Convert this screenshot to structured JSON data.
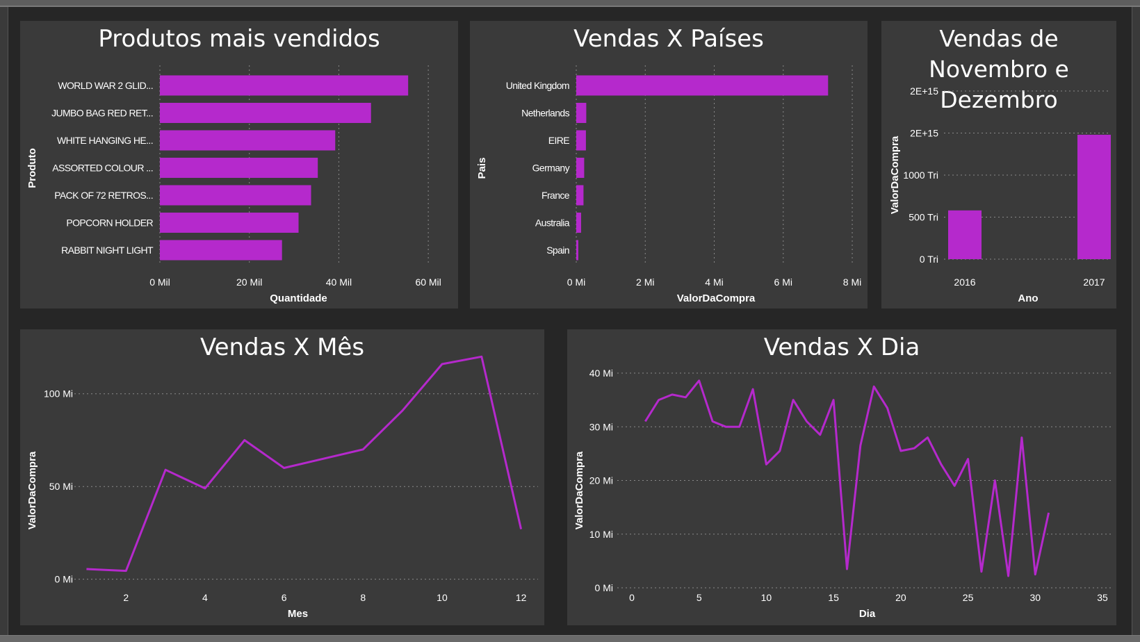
{
  "dashboard": {
    "accent_color": "#b529cc",
    "background_color": "#262626",
    "panel_color": "#3a3a3a"
  },
  "chart_data": [
    {
      "id": "produtos",
      "type": "bar",
      "orientation": "horizontal",
      "title": "Produtos mais vendidos",
      "xlabel": "Quantidade",
      "ylabel": "Produto",
      "categories": [
        "WORLD WAR 2 GLID...",
        "JUMBO BAG RED RET...",
        "WHITE HANGING HE...",
        "ASSORTED COLOUR ...",
        "PACK OF 72 RETROS...",
        "POPCORN HOLDER",
        "RABBIT NIGHT LIGHT"
      ],
      "values": [
        55500,
        47200,
        39200,
        35300,
        33800,
        31000,
        27300
      ],
      "xlim": [
        0,
        62000
      ],
      "xticks": [
        0,
        20000,
        40000,
        60000
      ],
      "xtick_labels": [
        "0 Mil",
        "20 Mil",
        "40 Mil",
        "60 Mil"
      ],
      "grid": "vertical-dotted"
    },
    {
      "id": "paises",
      "type": "bar",
      "orientation": "horizontal",
      "title": "Vendas X Países",
      "xlabel": "ValorDaCompra",
      "ylabel": "Pais",
      "categories": [
        "United Kingdom",
        "Netherlands",
        "EIRE",
        "Germany",
        "France",
        "Australia",
        "Spain"
      ],
      "values": [
        7300000,
        290000,
        280000,
        230000,
        210000,
        140000,
        60000
      ],
      "xlim": [
        0,
        8100000
      ],
      "xticks": [
        0,
        2000000,
        4000000,
        6000000,
        8000000
      ],
      "xtick_labels": [
        "0 Mi",
        "2 Mi",
        "4 Mi",
        "6 Mi",
        "8 Mi"
      ],
      "grid": "vertical-dotted"
    },
    {
      "id": "novdez",
      "type": "bar",
      "title": "Vendas de Novembro e Dezembro",
      "xlabel": "Ano",
      "ylabel": "ValorDaCompra",
      "categories": [
        "2016",
        "2017"
      ],
      "values": [
        580000000000000,
        1480000000000000
      ],
      "ylim": [
        0,
        2000000000000000
      ],
      "yticks": [
        0,
        500000000000000,
        1000000000000000,
        1500000000000000,
        2000000000000000
      ],
      "ytick_labels": [
        "0 Tri",
        "500 Tri",
        "1000 Tri",
        "2E+15",
        "2E+15"
      ],
      "grid": "horizontal-dotted"
    },
    {
      "id": "mes",
      "type": "line",
      "title": "Vendas X Mês",
      "xlabel": "Mes",
      "ylabel": "ValorDaCompra",
      "x": [
        1,
        2,
        3,
        4,
        5,
        6,
        7,
        8,
        9,
        10,
        11,
        12
      ],
      "y": [
        5500000,
        4500000,
        59000000,
        49000000,
        75000000,
        60000000,
        65000000,
        70000000,
        91000000,
        116000000,
        120000000,
        27000000
      ],
      "xlim": [
        0.5,
        12.2
      ],
      "ylim": [
        -5000000,
        125000000
      ],
      "xticks": [
        2,
        4,
        6,
        8,
        10,
        12
      ],
      "xtick_labels": [
        "2",
        "4",
        "6",
        "8",
        "10",
        "12"
      ],
      "yticks": [
        0,
        50000000,
        100000000
      ],
      "ytick_labels": [
        "0 Mi",
        "50 Mi",
        "100 Mi"
      ],
      "grid": "horizontal-dotted"
    },
    {
      "id": "dia",
      "type": "line",
      "title": "Vendas X Dia",
      "xlabel": "Dia",
      "ylabel": "ValorDaCompra",
      "x": [
        1,
        2,
        3,
        4,
        5,
        6,
        7,
        8,
        9,
        10,
        11,
        12,
        13,
        14,
        15,
        16,
        17,
        18,
        19,
        20,
        21,
        22,
        23,
        24,
        25,
        26,
        27,
        28,
        29,
        30,
        31
      ],
      "y": [
        31000000,
        35000000,
        36000000,
        35500000,
        38600000,
        31000000,
        30000000,
        30000000,
        37000000,
        23000000,
        25500000,
        35000000,
        31000000,
        28500000,
        35000000,
        3500000,
        26500000,
        37500000,
        33500000,
        25500000,
        26000000,
        28000000,
        23000000,
        19000000,
        24000000,
        3000000,
        20000000,
        2200000,
        28000000,
        2500000,
        14000000
      ],
      "xlim": [
        0,
        35
      ],
      "ylim": [
        0,
        40000000
      ],
      "xticks": [
        0,
        5,
        10,
        15,
        20,
        25,
        30,
        35
      ],
      "xtick_labels": [
        "0",
        "5",
        "10",
        "15",
        "20",
        "25",
        "30",
        "35"
      ],
      "yticks": [
        0,
        10000000,
        20000000,
        30000000,
        40000000
      ],
      "ytick_labels": [
        "0 Mi",
        "10 Mi",
        "20 Mi",
        "30 Mi",
        "40 Mi"
      ],
      "grid": "horizontal-dotted"
    }
  ]
}
